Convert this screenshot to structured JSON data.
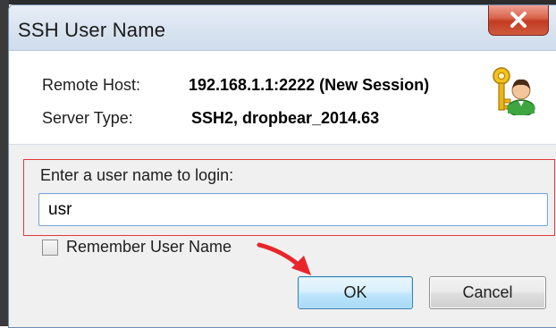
{
  "window": {
    "title": "SSH User Name"
  },
  "info": {
    "remote_host_label": "Remote Host:",
    "remote_host_value": "192.168.1.1:2222 (New Session)",
    "server_type_label": "Server Type:",
    "server_type_value": "SSH2, dropbear_2014.63",
    "icon": "keys-user-icon"
  },
  "login": {
    "prompt": "Enter a user name to login:",
    "username_value": "usr",
    "remember_label": "Remember User Name",
    "remember_checked": false
  },
  "buttons": {
    "ok": "OK",
    "cancel": "Cancel"
  },
  "icons": [
    "close-icon",
    "keys-user-icon",
    "arrow-annotation-icon"
  ],
  "colors": {
    "highlight": "#e23a3a",
    "ok_border": "#3c7fb1",
    "close_button": "#c23b21",
    "arrow": "#e8262a"
  }
}
